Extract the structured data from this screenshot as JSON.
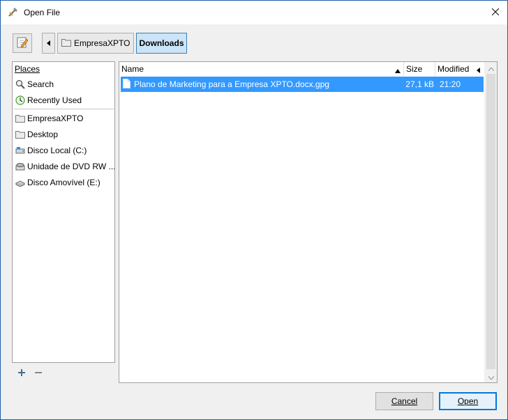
{
  "window": {
    "title": "Open File"
  },
  "toolbar": {
    "path": [
      {
        "label": "EmpresaXPTO",
        "active": false
      },
      {
        "label": "Downloads",
        "active": true
      }
    ]
  },
  "places": {
    "header": "Places",
    "items_top": [
      {
        "label": "Search",
        "icon": "search-icon"
      },
      {
        "label": "Recently Used",
        "icon": "recent-icon"
      }
    ],
    "items_bottom": [
      {
        "label": "EmpresaXPTO",
        "icon": "folder-icon"
      },
      {
        "label": "Desktop",
        "icon": "folder-icon"
      },
      {
        "label": "Disco Local (C:)",
        "icon": "drive-icon"
      },
      {
        "label": "Unidade de DVD RW ...",
        "icon": "dvd-icon"
      },
      {
        "label": "Disco Amovível (E:)",
        "icon": "removable-drive-icon"
      }
    ]
  },
  "files": {
    "columns": {
      "name": "Name",
      "size": "Size",
      "modified": "Modified"
    },
    "rows": [
      {
        "name": "Plano de Marketing para a Empresa XPTO.docx.gpg",
        "size": "27,1 kB",
        "modified": "21:20",
        "selected": true
      }
    ]
  },
  "buttons": {
    "cancel": "Cancel",
    "open": "Open"
  },
  "colors": {
    "selection": "#3399ff",
    "window_border": "#1e5ea8",
    "default_button_border": "#0078d7"
  }
}
